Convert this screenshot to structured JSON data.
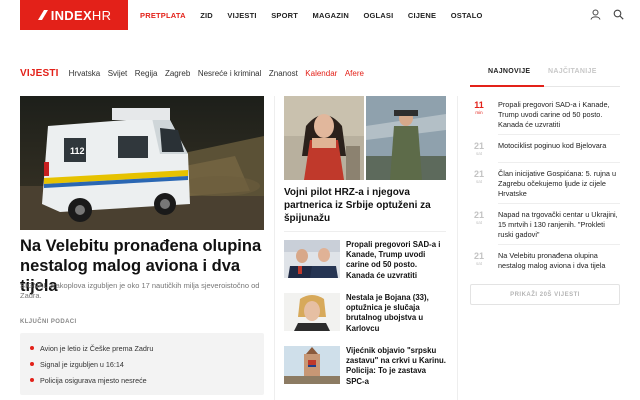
{
  "header": {
    "logo_text": "INDEX",
    "logo_suffix": "HR",
    "nav": [
      "PRETPLATA",
      "ZID",
      "VIJESTI",
      "SPORT",
      "MAGAZIN",
      "OGLASI",
      "CIJENE",
      "OSTALO"
    ],
    "brand_color": "#e32119",
    "icons": [
      "user-icon",
      "search-icon"
    ]
  },
  "section": {
    "title": "VIJESTI",
    "items": [
      "Hrvatska",
      "Svijet",
      "Regija",
      "Zagreb",
      "Nesreće i kriminal",
      "Znanost",
      "Kalendar",
      "Afere"
    ]
  },
  "tabs": {
    "active": "NAJNOVIJE",
    "inactive": "NAJČITANIJE"
  },
  "main_story": {
    "title": "Na Velebitu pronađena olupina nestalog malog aviona i dva tijela",
    "subtitle": "SIGNAL zrakoplova izgubljen je oko 17 nautičkih milja sjeveroistočno od Zadra.",
    "key_points_label": "KLJUČNI PODACI",
    "key_points": [
      "Avion je letio iz Češke prema Zadru",
      "Signal je izgubljen u 16:14",
      "Policija osigurava mjesto nesreće"
    ],
    "image_badge": "112"
  },
  "feature": {
    "title": "Vojni pilot HRZ-a i njegova partnerica iz Srbije optuženi za špijunažu"
  },
  "mid_list": [
    {
      "title": "Propali pregovori SAD-a i Kanade, Trump uvodi carine od 50 posto. Kanada će uzvratiti"
    },
    {
      "title": "Nestala je Bojana (33), optužnica je slučaja brutalnog ubojstva u Karlovcu"
    },
    {
      "title": "Vijećnik objavio \"srpsku zastavu\" na crkvi u Karinu. Policija: To je zastava SPC-a"
    }
  ],
  "right_list": [
    {
      "time": "11",
      "unit": "min",
      "text": "Propali pregovori SAD-a i Kanade, Trump uvodi carine od 50 posto. Kanada će uzvratiti",
      "highlight": true
    },
    {
      "time": "21",
      "unit": "sat",
      "text": "Motociklist poginuo kod Bjelovara",
      "highlight": false
    },
    {
      "time": "21",
      "unit": "sat",
      "text": "Član inicijative Gospićana: 5. rujna u Zagrebu očekujemo ljude iz cijele Hrvatske",
      "highlight": false
    },
    {
      "time": "21",
      "unit": "sat",
      "text": "Napad na trgovački centar u Ukrajini, 15 mrtvih i 130 ranjenih. \"Prokleti ruski gadovi\"",
      "highlight": false
    },
    {
      "time": "21",
      "unit": "sat",
      "text": "Na Velebitu pronađena olupina nestalog malog aviona i dva tijela",
      "highlight": false
    }
  ],
  "more_button": "PRIKAŽI 20Š VIJESTI"
}
